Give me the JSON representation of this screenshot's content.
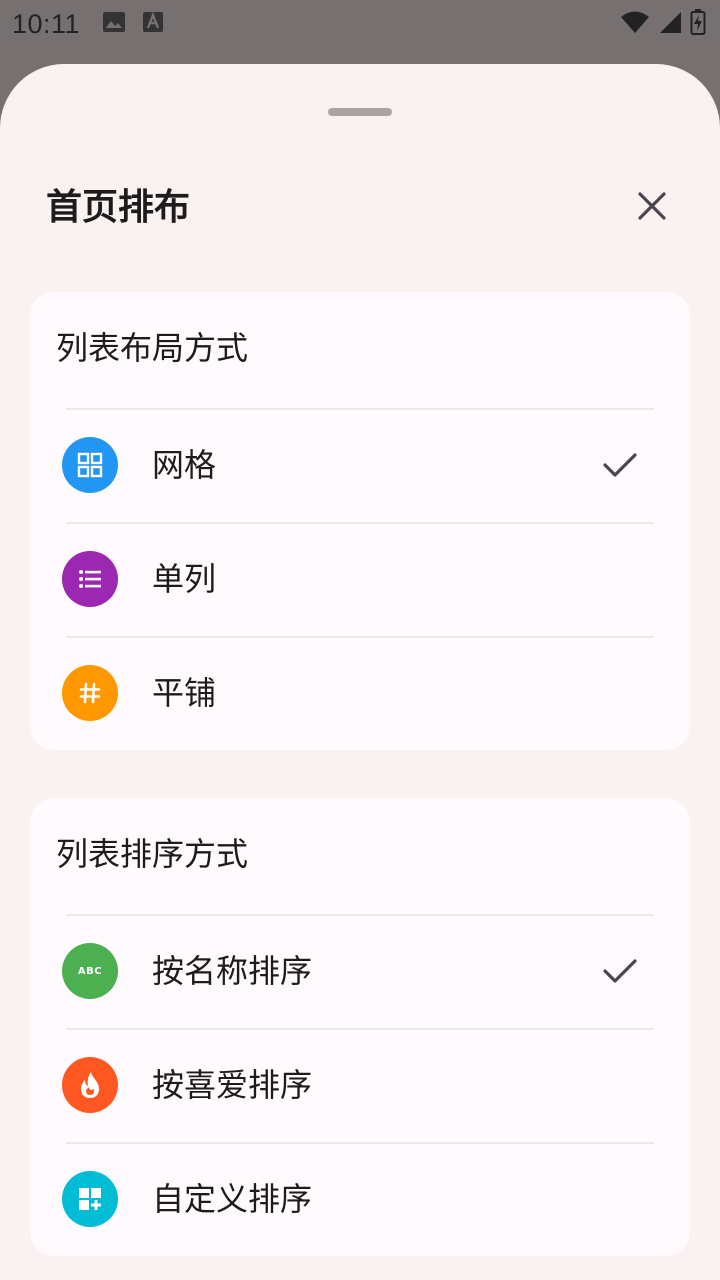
{
  "status_bar": {
    "time": "10:11",
    "left_icons": [
      "image-icon",
      "text-a-icon"
    ],
    "right_icons": [
      "wifi-icon",
      "signal-icon",
      "battery-charging-icon"
    ]
  },
  "sheet": {
    "title": "首页排布",
    "close_icon": "close-icon"
  },
  "layout_section": {
    "title": "列表布局方式",
    "options": [
      {
        "label": "网格",
        "icon": "grid-icon",
        "color": "#2196f3",
        "selected": true
      },
      {
        "label": "单列",
        "icon": "list-icon",
        "color": "#9c27b0",
        "selected": false
      },
      {
        "label": "平铺",
        "icon": "hash-icon",
        "color": "#ff9800",
        "selected": false
      }
    ]
  },
  "sort_section": {
    "title": "列表排序方式",
    "options": [
      {
        "label": "按名称排序",
        "icon": "abc-icon",
        "icon_text": "ABC",
        "color": "#4caf50",
        "selected": true
      },
      {
        "label": "按喜爱排序",
        "icon": "flame-icon",
        "color": "#ff5722",
        "selected": false
      },
      {
        "label": "自定义排序",
        "icon": "widgets-add-icon",
        "color": "#00bcd4",
        "selected": false
      }
    ]
  }
}
